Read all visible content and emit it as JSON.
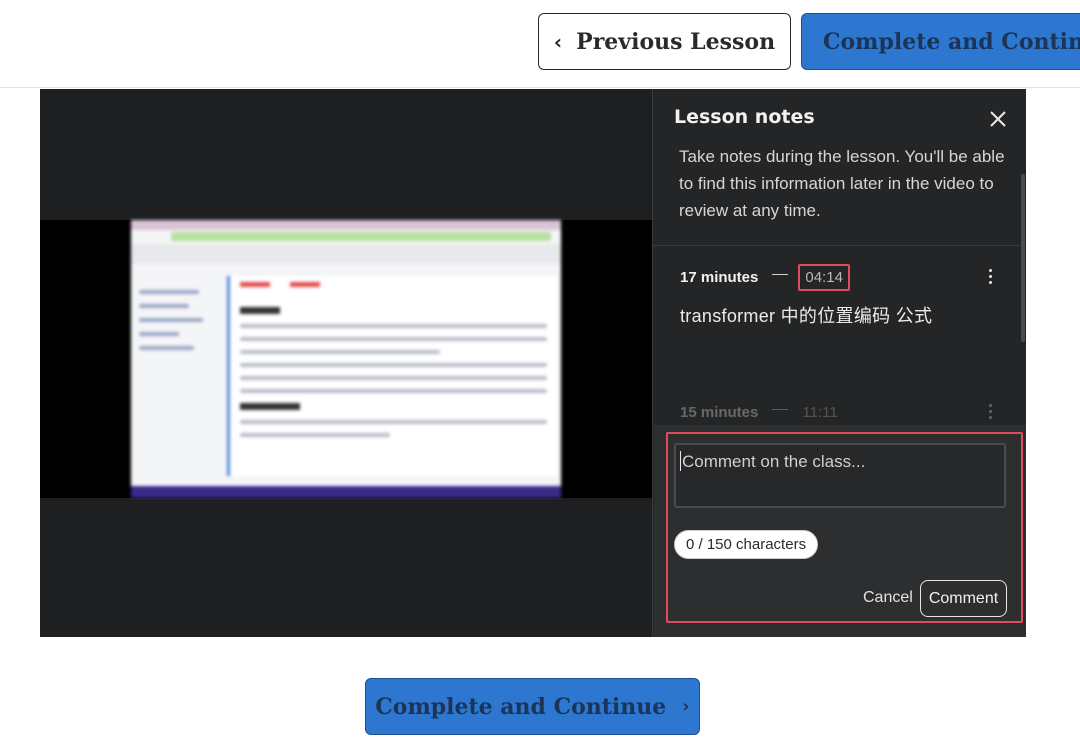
{
  "header": {
    "previous_label": "Previous Lesson",
    "previous_icon": "chevron-left-icon",
    "complete_label": "Complete and Continue"
  },
  "notes_panel": {
    "title": "Lesson notes",
    "close_icon": "close-icon",
    "intro": "Take notes during the lesson. You'll be able to find this information later in the video to review at any time.",
    "notes": [
      {
        "duration": "17 minutes",
        "timestamp": "04:14",
        "text": "transformer 中的位置编码 公式"
      },
      {
        "duration": "15 minutes",
        "timestamp": "11:11",
        "text": ""
      }
    ]
  },
  "composer": {
    "placeholder": "Comment on the class...",
    "char_count": "0 / 150 characters",
    "cancel_label": "Cancel",
    "comment_label": "Comment"
  },
  "footer": {
    "complete_label": "Complete and Continue",
    "chevron_icon": "chevron-right-icon"
  },
  "colors": {
    "accent_blue": "#2e77d0",
    "highlight_red": "#e34a5b",
    "panel_dark": "#242526"
  }
}
